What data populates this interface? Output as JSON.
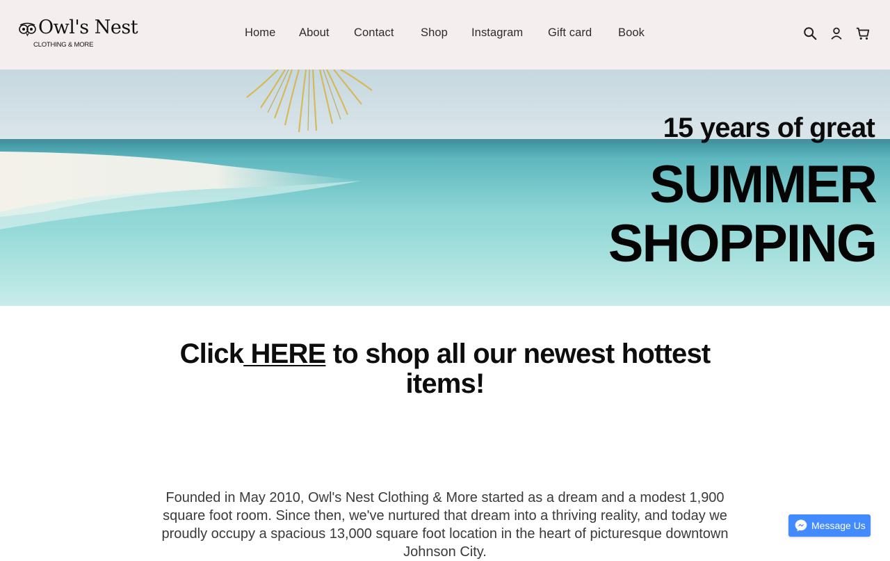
{
  "brand": {
    "logo_text": "Owl's Nest",
    "logo_subtext": "CLOTHING & MORE"
  },
  "nav": {
    "items": [
      "Home",
      "About",
      "Contact",
      "Shop",
      "Instagram",
      "Gift card",
      "Book"
    ]
  },
  "header_icons": [
    "search-icon",
    "account-icon",
    "cart-icon"
  ],
  "hero": {
    "line1": "15 years of great",
    "line2": "SUMMER",
    "line3": "SHOPPING"
  },
  "cta": {
    "prefix": "Click",
    "link": " HERE",
    "suffix": " to shop all our newest hottest items!"
  },
  "about": {
    "text": "Founded in May 2010, Owl's Nest Clothing & More started as a dream and a modest 1,900 square foot room. Since then, we've nurtured that dream into a thriving reality, and today we proudly occupy a spacious 13,000 square foot location in the heart of picturesque downtown Johnson City."
  },
  "messenger": {
    "label": "Message Us"
  },
  "colors": {
    "header_bg": "#f5eeee",
    "messenger_blue": "#448aff",
    "sky": "#cfdfe6",
    "sea": "#7fd4d6"
  }
}
